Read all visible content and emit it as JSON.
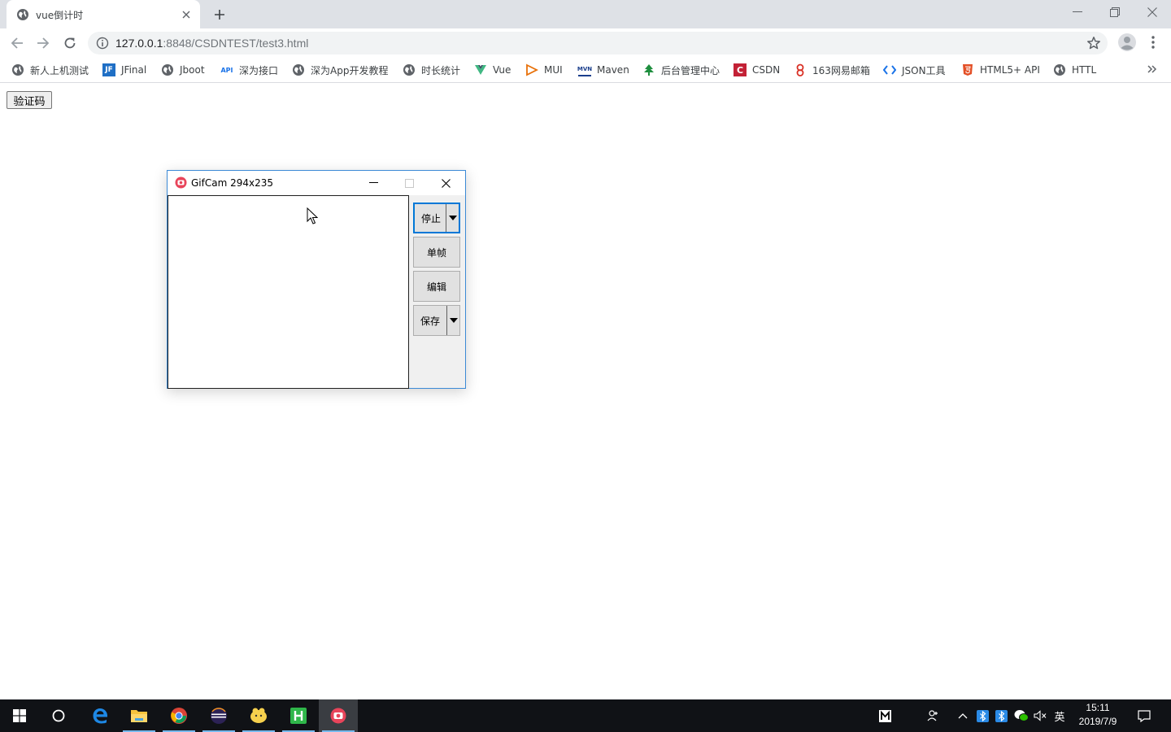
{
  "browser": {
    "tab": {
      "title": "vue倒计时"
    },
    "address": {
      "host": "127.0.0.1",
      "path": ":8848/CSDNTEST/test3.html"
    },
    "bookmarks": [
      {
        "label": "新人上机测试",
        "icon": "globe-icon"
      },
      {
        "label": "JFinal",
        "icon": "jfinal-icon"
      },
      {
        "label": "Jboot",
        "icon": "globe-icon"
      },
      {
        "label": "深为接口",
        "icon": "api-icon"
      },
      {
        "label": "深为App开发教程",
        "icon": "globe-icon"
      },
      {
        "label": "时长统计",
        "icon": "globe-icon"
      },
      {
        "label": "Vue",
        "icon": "vue-icon"
      },
      {
        "label": "MUI",
        "icon": "mui-icon"
      },
      {
        "label": "Maven",
        "icon": "maven-icon"
      },
      {
        "label": "后台管理中心",
        "icon": "tree-icon"
      },
      {
        "label": "CSDN",
        "icon": "csdn-icon"
      },
      {
        "label": "163网易邮箱",
        "icon": "mail163-icon"
      },
      {
        "label": "JSON工具",
        "icon": "code-icon"
      },
      {
        "label": "HTML5+ API",
        "icon": "html5-icon"
      },
      {
        "label": "HTTL",
        "icon": "globe-icon"
      }
    ]
  },
  "page": {
    "captcha_button": "验证码"
  },
  "gifcam": {
    "title": "GifCam 294x235",
    "buttons": {
      "stop": "停止",
      "single_frame": "单帧",
      "edit": "编辑",
      "save": "保存"
    }
  },
  "taskbar": {
    "ime": "英",
    "clock": {
      "time": "15:11",
      "date": "2019/7/9"
    }
  },
  "colors": {
    "accent": "#0078d7",
    "tabstrip": "#dee1e6",
    "taskbar": "#101216"
  }
}
